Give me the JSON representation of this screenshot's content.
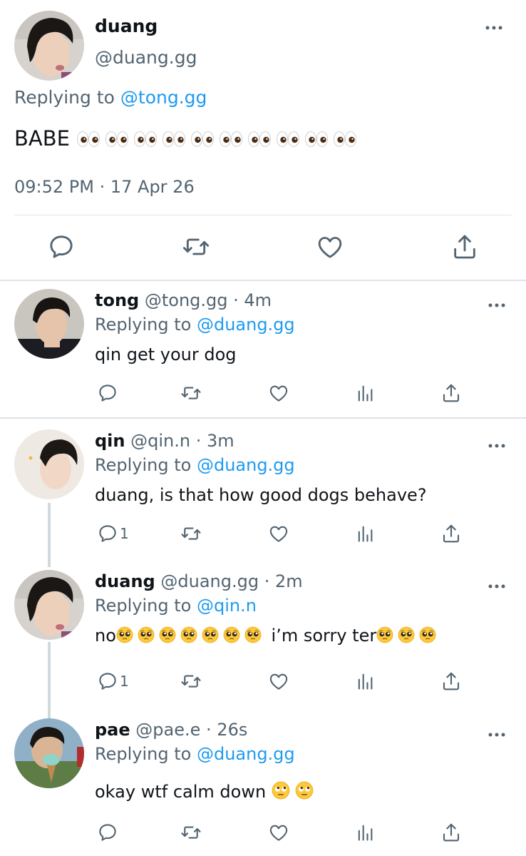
{
  "main_tweet": {
    "name": "duang",
    "handle": "@duang.gg",
    "replying_prefix": "Replying to",
    "replying_to": "@tong.gg",
    "text": "BABE",
    "emoji_count": 10,
    "timestamp": "09:52 PM · 17 Apr 26"
  },
  "replies": [
    {
      "name": "tong",
      "handle": "@tong.gg",
      "time": "· 4m",
      "replying_prefix": "Replying to",
      "replying_to": "@duang.gg",
      "text": "qin get your dog",
      "reply_count": "",
      "has_thread_line": false
    },
    {
      "name": "qin",
      "handle": "@qin.n",
      "time": "· 3m",
      "replying_prefix": "Replying to",
      "replying_to": "@duang.gg",
      "text": "duang, is that how good dogs behave?",
      "reply_count": "1",
      "has_thread_line": true
    },
    {
      "name": "duang",
      "handle": "@duang.gg",
      "time": "· 2m",
      "replying_prefix": "Replying to",
      "replying_to": "@qin.n",
      "text_a": "no",
      "text_b": "i’m sorry ter",
      "reply_count": "1",
      "has_thread_line": true
    },
    {
      "name": "pae",
      "handle": "@pae.e",
      "time": "· 26s",
      "replying_prefix": "Replying to",
      "replying_to": "@duang.gg",
      "text": "okay wtf calm down",
      "reply_count": "",
      "has_thread_line": false
    }
  ],
  "icons": {
    "reply": "reply-icon",
    "retweet": "retweet-icon",
    "like": "heart-icon",
    "analytics": "analytics-icon",
    "share": "share-icon",
    "more": "more-icon",
    "eyes_emoji": "eyes-emoji",
    "pleading_emoji": "pleading-face-emoji",
    "eye_roll_emoji": "eye-roll-emoji"
  },
  "colors": {
    "text": "#0f1419",
    "secondary": "#536471",
    "link": "#1d9bf0",
    "divider": "#e1e5e9"
  }
}
